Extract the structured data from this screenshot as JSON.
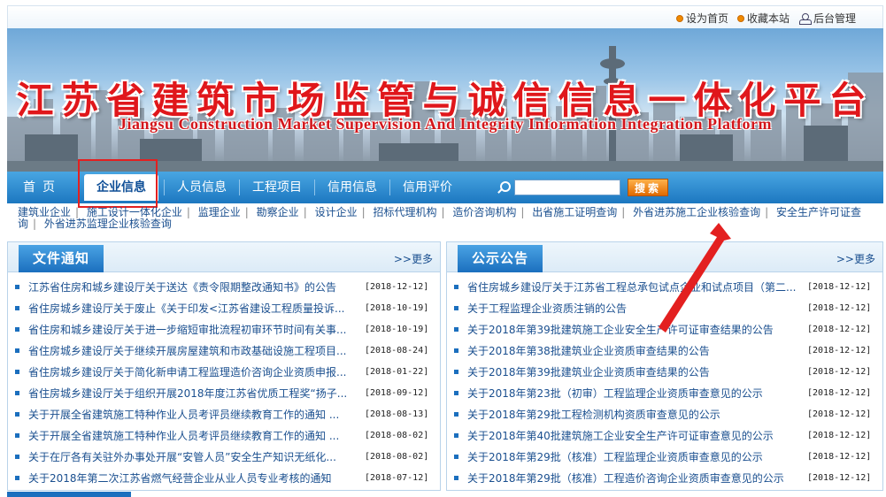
{
  "toplinks": {
    "home": "设为首页",
    "favorite": "收藏本站",
    "admin": "后台管理"
  },
  "banner": {
    "title": "江苏省建筑市场监管与诚信信息一体化平台",
    "subtitle": "Jiangsu Construction Market Supervision And Integrity Information Integration Platform"
  },
  "nav": {
    "items": [
      "首页",
      "企业信息",
      "人员信息",
      "工程项目",
      "信用信息",
      "信用评价"
    ],
    "active": "企业信息",
    "search_value": "",
    "search_button": "搜索"
  },
  "subnav": {
    "items": [
      "建筑业企业",
      "施工设计一体化企业",
      "监理企业",
      "勘察企业",
      "设计企业",
      "招标代理机构",
      "造价咨询机构",
      "出省施工证明查询",
      "外省进苏施工企业核验查询",
      "安全生产许可证查询",
      "外省进苏监理企业核验查询"
    ]
  },
  "left_panel": {
    "title": "文件通知",
    "more": ">>更多",
    "items": [
      {
        "title": "江苏省住房和城乡建设厅关于送达《责令限期整改通知书》的公告",
        "date": "[2018-12-12]"
      },
      {
        "title": "省住房城乡建设厅关于废止《关于印发<江苏省建设工程质量投诉...",
        "date": "[2018-10-19]"
      },
      {
        "title": "省住房和城乡建设厅关于进一步缩短审批流程初审环节时间有关事...",
        "date": "[2018-10-19]"
      },
      {
        "title": "省住房城乡建设厅关于继续开展房屋建筑和市政基础设施工程项目...",
        "date": "[2018-08-24]"
      },
      {
        "title": "省住房城乡建设厅关于简化新申请工程监理造价咨询企业资质申报...",
        "date": "[2018-01-22]"
      },
      {
        "title": "省住房城乡建设厅关于组织开展2018年度江苏省优质工程奖“扬子...",
        "date": "[2018-09-12]"
      },
      {
        "title": "关于开展全省建筑施工特种作业人员考评员继续教育工作的通知 ...",
        "date": "[2018-08-13]"
      },
      {
        "title": "关于开展全省建筑施工特种作业人员考评员继续教育工作的通知 ...",
        "date": "[2018-08-02]"
      },
      {
        "title": "关于在厅各有关驻外办事处开展“安管人员”安全生产知识无纸化...",
        "date": "[2018-08-02]"
      },
      {
        "title": "关于2018年第二次江苏省燃气经营企业从业人员专业考核的通知",
        "date": "[2018-07-12]"
      }
    ]
  },
  "right_panel": {
    "title": "公示公告",
    "more": ">>更多",
    "items": [
      {
        "title": "省住房城乡建设厅关于江苏省工程总承包试点企业和试点项目（第二...",
        "date": "[2018-12-12]"
      },
      {
        "title": "关于工程监理企业资质注销的公告",
        "date": "[2018-12-12]"
      },
      {
        "title": "关于2018年第39批建筑施工企业安全生产许可证审查结果的公告",
        "date": "[2018-12-12]"
      },
      {
        "title": "关于2018年第38批建筑业企业资质审查结果的公告",
        "date": "[2018-12-12]"
      },
      {
        "title": "关于2018年第39批建筑业企业资质审查结果的公告",
        "date": "[2018-12-12]"
      },
      {
        "title": "关于2018年第23批（初审）工程监理企业资质审查意见的公示",
        "date": "[2018-12-12]"
      },
      {
        "title": "关于2018年第29批工程检测机构资质审查意见的公示",
        "date": "[2018-12-12]"
      },
      {
        "title": "关于2018年第40批建筑施工企业安全生产许可证审查意见的公示",
        "date": "[2018-12-12]"
      },
      {
        "title": "关于2018年第29批（核准）工程监理企业资质审查意见的公示",
        "date": "[2018-12-12]"
      },
      {
        "title": "关于2018年第29批（核准）工程造价咨询企业资质审查意见的公示",
        "date": "[2018-12-12]"
      }
    ]
  },
  "colors": {
    "nav": "#1c77c0",
    "title_red": "#e0171b",
    "link": "#1a4f8f",
    "annotation": "#e32020"
  }
}
